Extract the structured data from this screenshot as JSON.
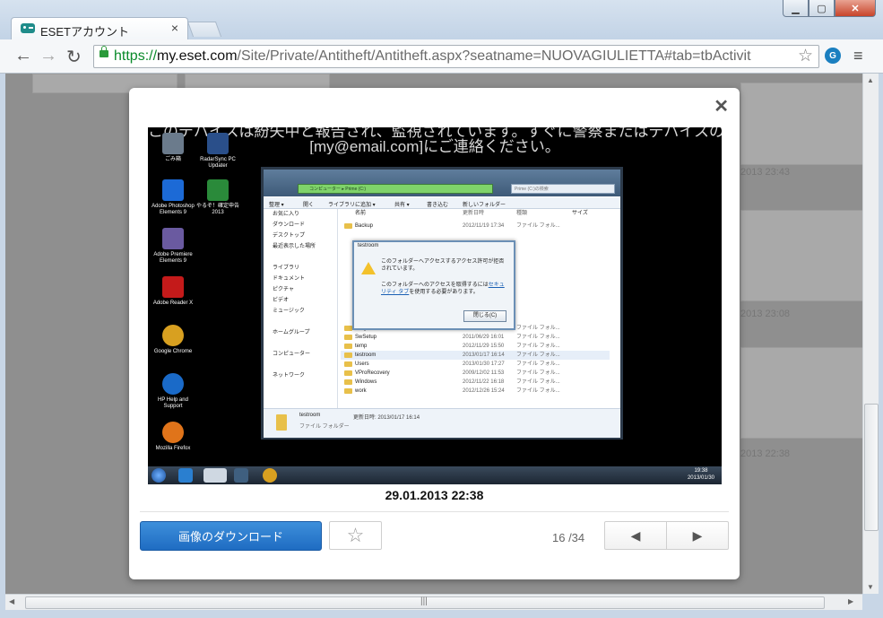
{
  "browser": {
    "tab_title": "ESETアカウント",
    "url_scheme": "https://",
    "url_host": "my.eset.com",
    "url_path": "/Site/Private/Antitheft/Antitheft.aspx?seatname=NUOVAGIULIETTA#tab=tbActivit",
    "accent_color": "#1f6cc2"
  },
  "background_times": [
    "2013 23:43",
    "2013 23:08",
    "2013 22:38"
  ],
  "modal": {
    "caption": "29.01.2013 22:38",
    "download_label": "画像のダウンロード",
    "counter": "16 /34",
    "prev_label": "◀",
    "next_label": "▶"
  },
  "screenshot": {
    "warning_line1": "このデバイスは紛失中と報告され、監視されています。すぐに警察またはデバイスの所有者に",
    "warning_line2": "[my@email.com]にご連絡ください。",
    "desktop_icons": [
      {
        "label": "ごみ箱",
        "color": "#6b7b8c"
      },
      {
        "label": "RadarSync PC Updater",
        "color": "#2a4f8a"
      },
      {
        "label": "Adobe Photoshop Elements 9",
        "color": "#1c6ad6"
      },
      {
        "label": "やるぞ！確定申告 2013",
        "color": "#2a8a3a"
      },
      {
        "label": "Adobe Premiere Elements 9",
        "color": "#6a5aa0"
      },
      {
        "label": "Adobe Reader X",
        "color": "#c41a1a"
      },
      {
        "label": "Google Chrome",
        "color": "#d8a020"
      },
      {
        "label": "HP Help and Support",
        "color": "#1a6ac8"
      },
      {
        "label": "Mozilla Firefox",
        "color": "#e0741a"
      }
    ],
    "explorer": {
      "address": "コンピューター ▸ Prime (C:)",
      "search": "Prime (C:)の検索",
      "toolbar": [
        "整理 ▾",
        "開く",
        "ライブラリに追加 ▾",
        "共有 ▾",
        "書き込む",
        "新しいフォルダー"
      ],
      "col_name": "名前",
      "col_date": "更新日時",
      "col_type": "種類",
      "col_size": "サイズ",
      "sidebar": [
        "お気に入り",
        "ダウンロード",
        "デスクトップ",
        "最近表示した場所",
        "",
        "ライブラリ",
        "ドキュメント",
        "ピクチャ",
        "ビデオ",
        "ミュージック",
        "",
        "ホームグループ",
        "",
        "コンピューター",
        "",
        "ネットワーク"
      ],
      "rows": [
        {
          "name": "Backup",
          "date": "2012/11/19 17:34",
          "type": "ファイル フォル..."
        },
        {
          "name": "Program Files",
          "date": "2013/01/25 13:51",
          "type": "ファイル フォル..."
        },
        {
          "name": "SwSetup",
          "date": "2011/06/29 16:01",
          "type": "ファイル フォル..."
        },
        {
          "name": "temp",
          "date": "2012/11/29 15:50",
          "type": "ファイル フォル..."
        },
        {
          "name": "testroom",
          "date": "2013/01/17 16:14",
          "type": "ファイル フォル..."
        },
        {
          "name": "Users",
          "date": "2013/01/30 17:27",
          "type": "ファイル フォル..."
        },
        {
          "name": "VProRecovery",
          "date": "2009/12/02 11:53",
          "type": "ファイル フォル..."
        },
        {
          "name": "Windows",
          "date": "2012/11/22 16:18",
          "type": "ファイル フォル..."
        },
        {
          "name": "work",
          "date": "2012/12/26 15:24",
          "type": "ファイル フォル..."
        }
      ],
      "status_name": "testroom",
      "status_date": "更新日時: 2013/01/17 16:14",
      "status_type": "ファイル フォルダー"
    },
    "dialog": {
      "title": "testroom",
      "message1": "このフォルダーへアクセスするアクセス許可が拒否されています。",
      "message2_pre": "このフォルダーへのアクセスを取得するには",
      "message2_link": "セキュリティ タブ",
      "message2_post": "を使用する必要があります。",
      "button": "閉じる(C)"
    },
    "clock_time": "19:38",
    "clock_date": "2013/01/30"
  }
}
